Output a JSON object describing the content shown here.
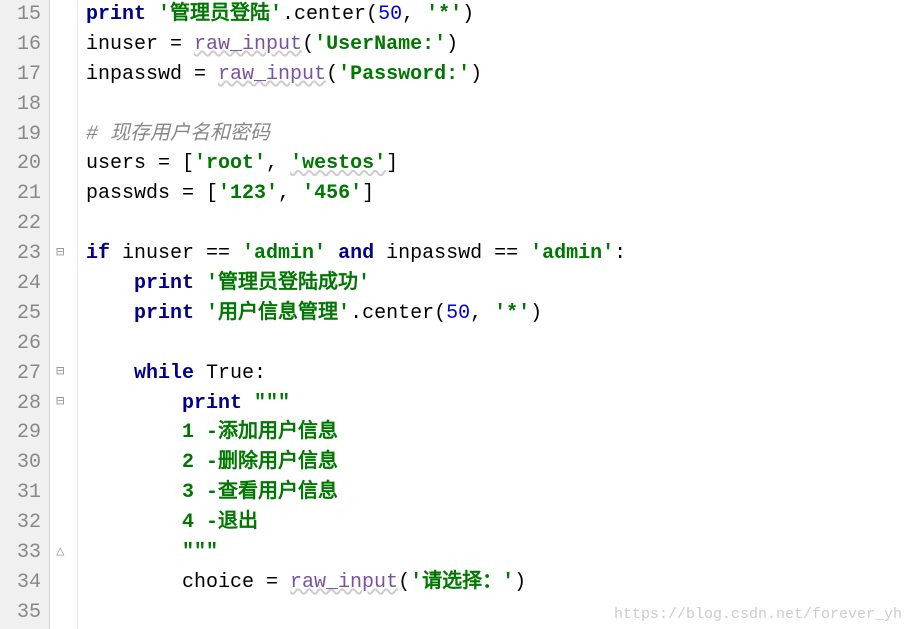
{
  "line_numbers": [
    "15",
    "16",
    "17",
    "18",
    "19",
    "20",
    "21",
    "22",
    "23",
    "24",
    "25",
    "26",
    "27",
    "28",
    "29",
    "30",
    "31",
    "32",
    "33",
    "34",
    "35"
  ],
  "code": {
    "l15": {
      "kw": "print",
      "str": "'管理员登陆'",
      "fn": ".center(",
      "num": "50",
      "tail": ", ",
      "star": "'*'",
      "close": ")"
    },
    "l16": {
      "var": "inuser = ",
      "fn": "raw_input",
      "open": "(",
      "str": "'UserName:'",
      "close": ")"
    },
    "l17": {
      "var": "inpasswd = ",
      "fn": "raw_input",
      "open": "(",
      "str": "'Password:'",
      "close": ")"
    },
    "l19": {
      "comment": "# 现存用户名和密码"
    },
    "l20": {
      "var": "users = [",
      "s1": "'root'",
      "c": ", ",
      "s2": "'westos'",
      "close": "]"
    },
    "l21": {
      "var": "passwds = [",
      "s1": "'123'",
      "c": ", ",
      "s2": "'456'",
      "close": "]"
    },
    "l23": {
      "kw1": "if",
      "mid1": " inuser == ",
      "s1": "'admin'",
      "kw2": " and ",
      "mid2": "inpasswd == ",
      "s2": "'admin'",
      "colon": ":"
    },
    "l24": {
      "kw": "print",
      "str": "'管理员登陆成功'"
    },
    "l25": {
      "kw": "print",
      "str": "'用户信息管理'",
      "fn": ".center(",
      "num": "50",
      "tail": ", ",
      "star": "'*'",
      "close": ")"
    },
    "l27": {
      "kw": "while",
      "cond": " True:"
    },
    "l28": {
      "kw": "print",
      "str": "\"\"\""
    },
    "l29": {
      "str": "1 -添加用户信息"
    },
    "l30": {
      "str": "2 -删除用户信息"
    },
    "l31": {
      "str": "3 -查看用户信息"
    },
    "l32": {
      "str": "4 -退出"
    },
    "l33": {
      "str": "\"\"\""
    },
    "l34": {
      "var": "choice = ",
      "fn": "raw_input",
      "open": "(",
      "str": "'请选择：'",
      "close": ")"
    }
  },
  "watermark": "https://blog.csdn.net/forever_yh"
}
